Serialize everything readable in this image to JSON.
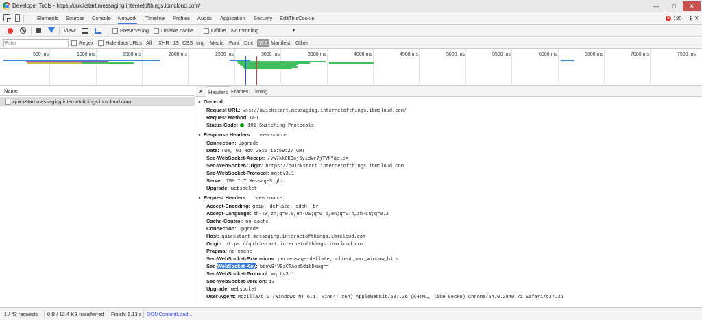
{
  "window": {
    "title": "Developer Tools - https://quickstart.messaging.internetofthings.ibmcloud.com/",
    "icon": "chrome-icon"
  },
  "tabs": {
    "items": [
      "Elements",
      "Sources",
      "Console",
      "Network",
      "Timeline",
      "Profiles",
      "Audits",
      "Application",
      "Security",
      "EditThisCookie"
    ],
    "active": "Network",
    "error_count": "180"
  },
  "toolbar": {
    "view_label": "View:",
    "preserve_log": "Preserve log",
    "disable_cache": "Disable cache",
    "offline": "Offline",
    "throttling": "No throttling",
    "record_color": "#e53935"
  },
  "filterbar": {
    "placeholder": "Filter",
    "regex": "Regex",
    "hide_data_urls": "Hide data URLs",
    "types": [
      "All",
      "XHR",
      "JS",
      "CSS",
      "Img",
      "Media",
      "Font",
      "Doc",
      "WS",
      "Manifest",
      "Other"
    ],
    "selected_type": "WS"
  },
  "timeline": {
    "ticks": [
      "500 ms",
      "1000 ms",
      "1500 ms",
      "2000 ms",
      "2500 ms",
      "3000 ms",
      "3500 ms",
      "4000 ms",
      "4500 ms",
      "5000 ms",
      "5500 ms",
      "6000 ms",
      "6500 ms",
      "7000 ms",
      "7500 ms"
    ]
  },
  "request_list": {
    "column_name": "Name",
    "requests": [
      "quickstart.messaging.internetofthings.ibmcloud.com"
    ]
  },
  "details": {
    "tabs": [
      "Headers",
      "Frames",
      "Timing"
    ],
    "active_tab": "Headers",
    "general": {
      "title": "General",
      "rows": [
        {
          "k": "Request URL:",
          "v": "wss://quickstart.messaging.internetofthings.ibmcloud.com/"
        },
        {
          "k": "Request Method:",
          "v": "GET"
        },
        {
          "k": "Status Code:",
          "v": "101 Switching Protocols"
        }
      ]
    },
    "response_headers": {
      "title": "Response Headers",
      "view_source": "view source",
      "rows": [
        {
          "k": "Connection:",
          "v": "Upgrade"
        },
        {
          "k": "Date:",
          "v": "Tue, 01 Nov 2016 15:59:27 GMT"
        },
        {
          "k": "Sec-WebSocket-Accept:",
          "v": "/vW7kkOKOoj6yidVr7jTVNYqolc="
        },
        {
          "k": "Sec-WebSocket-Origin:",
          "v": "https://quickstart.internetofthings.ibmcloud.com"
        },
        {
          "k": "Sec-WebSocket-Protocol:",
          "v": "mqttv3.1"
        },
        {
          "k": "Server:",
          "v": "IBM IoT MessageSight"
        },
        {
          "k": "Upgrade:",
          "v": "websocket"
        }
      ]
    },
    "request_headers": {
      "title": "Request Headers",
      "view_source": "view source",
      "rows": [
        {
          "k": "Accept-Encoding:",
          "v": "gzip, deflate, sdch, br"
        },
        {
          "k": "Accept-Language:",
          "v": "zh-TW,zh;q=0.8,en-US;q=0.6,en;q=0.4,zh-CN;q=0.2"
        },
        {
          "k": "Cache-Control:",
          "v": "no-cache"
        },
        {
          "k": "Connection:",
          "v": "Upgrade"
        },
        {
          "k": "Host:",
          "v": "quickstart.messaging.internetofthings.ibmcloud.com"
        },
        {
          "k": "Origin:",
          "v": "https://quickstart.internetofthings.ibmcloud.com"
        },
        {
          "k": "Pragma:",
          "v": "no-cache"
        },
        {
          "k": "Sec-WebSocket-Extensions:",
          "v": "permessage-deflate; client_max_window_bits"
        },
        {
          "k": "Sec-WebSocket-Key:",
          "v": "bbnW9jV9zCTAoz5dibDkwg=="
        },
        {
          "k": "Sec-WebSocket-Protocol:",
          "v": "mqttv3.1"
        },
        {
          "k": "Sec-WebSocket-Version:",
          "v": "13"
        },
        {
          "k": "Upgrade:",
          "v": "websocket"
        },
        {
          "k": "User-Agent:",
          "v": "Mozilla/5.0 (Windows NT 6.1; Win64; x64) AppleWebKit/537.36 (KHTML, like Gecko) Chrome/54.0.2840.71 Safari/537.36"
        }
      ],
      "highlight": {
        "prefix": "Sec-",
        "selected": "WebSocket-Key"
      }
    }
  },
  "statusbar": {
    "requests": "1 / 43 requests",
    "transferred": "0 B / 12.4 KB transferred",
    "finish": "Finish: 6.13 s",
    "domcontentloaded": "DOMContentLoad..."
  }
}
